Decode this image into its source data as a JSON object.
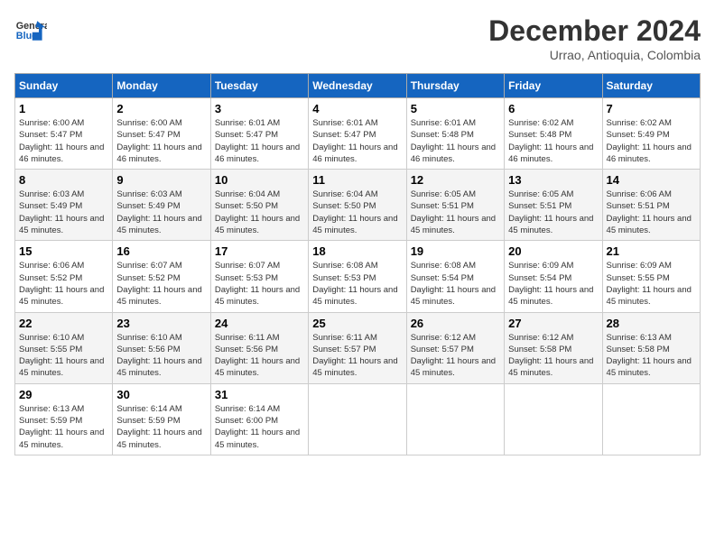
{
  "header": {
    "logo_general": "General",
    "logo_blue": "Blue",
    "month_title": "December 2024",
    "location": "Urrao, Antioquia, Colombia"
  },
  "weekdays": [
    "Sunday",
    "Monday",
    "Tuesday",
    "Wednesday",
    "Thursday",
    "Friday",
    "Saturday"
  ],
  "weeks": [
    [
      {
        "day": "1",
        "sunrise": "6:00 AM",
        "sunset": "5:47 PM",
        "daylight": "11 hours and 46 minutes."
      },
      {
        "day": "2",
        "sunrise": "6:00 AM",
        "sunset": "5:47 PM",
        "daylight": "11 hours and 46 minutes."
      },
      {
        "day": "3",
        "sunrise": "6:01 AM",
        "sunset": "5:47 PM",
        "daylight": "11 hours and 46 minutes."
      },
      {
        "day": "4",
        "sunrise": "6:01 AM",
        "sunset": "5:47 PM",
        "daylight": "11 hours and 46 minutes."
      },
      {
        "day": "5",
        "sunrise": "6:01 AM",
        "sunset": "5:48 PM",
        "daylight": "11 hours and 46 minutes."
      },
      {
        "day": "6",
        "sunrise": "6:02 AM",
        "sunset": "5:48 PM",
        "daylight": "11 hours and 46 minutes."
      },
      {
        "day": "7",
        "sunrise": "6:02 AM",
        "sunset": "5:49 PM",
        "daylight": "11 hours and 46 minutes."
      }
    ],
    [
      {
        "day": "8",
        "sunrise": "6:03 AM",
        "sunset": "5:49 PM",
        "daylight": "11 hours and 45 minutes."
      },
      {
        "day": "9",
        "sunrise": "6:03 AM",
        "sunset": "5:49 PM",
        "daylight": "11 hours and 45 minutes."
      },
      {
        "day": "10",
        "sunrise": "6:04 AM",
        "sunset": "5:50 PM",
        "daylight": "11 hours and 45 minutes."
      },
      {
        "day": "11",
        "sunrise": "6:04 AM",
        "sunset": "5:50 PM",
        "daylight": "11 hours and 45 minutes."
      },
      {
        "day": "12",
        "sunrise": "6:05 AM",
        "sunset": "5:51 PM",
        "daylight": "11 hours and 45 minutes."
      },
      {
        "day": "13",
        "sunrise": "6:05 AM",
        "sunset": "5:51 PM",
        "daylight": "11 hours and 45 minutes."
      },
      {
        "day": "14",
        "sunrise": "6:06 AM",
        "sunset": "5:51 PM",
        "daylight": "11 hours and 45 minutes."
      }
    ],
    [
      {
        "day": "15",
        "sunrise": "6:06 AM",
        "sunset": "5:52 PM",
        "daylight": "11 hours and 45 minutes."
      },
      {
        "day": "16",
        "sunrise": "6:07 AM",
        "sunset": "5:52 PM",
        "daylight": "11 hours and 45 minutes."
      },
      {
        "day": "17",
        "sunrise": "6:07 AM",
        "sunset": "5:53 PM",
        "daylight": "11 hours and 45 minutes."
      },
      {
        "day": "18",
        "sunrise": "6:08 AM",
        "sunset": "5:53 PM",
        "daylight": "11 hours and 45 minutes."
      },
      {
        "day": "19",
        "sunrise": "6:08 AM",
        "sunset": "5:54 PM",
        "daylight": "11 hours and 45 minutes."
      },
      {
        "day": "20",
        "sunrise": "6:09 AM",
        "sunset": "5:54 PM",
        "daylight": "11 hours and 45 minutes."
      },
      {
        "day": "21",
        "sunrise": "6:09 AM",
        "sunset": "5:55 PM",
        "daylight": "11 hours and 45 minutes."
      }
    ],
    [
      {
        "day": "22",
        "sunrise": "6:10 AM",
        "sunset": "5:55 PM",
        "daylight": "11 hours and 45 minutes."
      },
      {
        "day": "23",
        "sunrise": "6:10 AM",
        "sunset": "5:56 PM",
        "daylight": "11 hours and 45 minutes."
      },
      {
        "day": "24",
        "sunrise": "6:11 AM",
        "sunset": "5:56 PM",
        "daylight": "11 hours and 45 minutes."
      },
      {
        "day": "25",
        "sunrise": "6:11 AM",
        "sunset": "5:57 PM",
        "daylight": "11 hours and 45 minutes."
      },
      {
        "day": "26",
        "sunrise": "6:12 AM",
        "sunset": "5:57 PM",
        "daylight": "11 hours and 45 minutes."
      },
      {
        "day": "27",
        "sunrise": "6:12 AM",
        "sunset": "5:58 PM",
        "daylight": "11 hours and 45 minutes."
      },
      {
        "day": "28",
        "sunrise": "6:13 AM",
        "sunset": "5:58 PM",
        "daylight": "11 hours and 45 minutes."
      }
    ],
    [
      {
        "day": "29",
        "sunrise": "6:13 AM",
        "sunset": "5:59 PM",
        "daylight": "11 hours and 45 minutes."
      },
      {
        "day": "30",
        "sunrise": "6:14 AM",
        "sunset": "5:59 PM",
        "daylight": "11 hours and 45 minutes."
      },
      {
        "day": "31",
        "sunrise": "6:14 AM",
        "sunset": "6:00 PM",
        "daylight": "11 hours and 45 minutes."
      },
      null,
      null,
      null,
      null
    ]
  ],
  "labels": {
    "sunrise": "Sunrise: ",
    "sunset": "Sunset: ",
    "daylight": "Daylight: "
  }
}
